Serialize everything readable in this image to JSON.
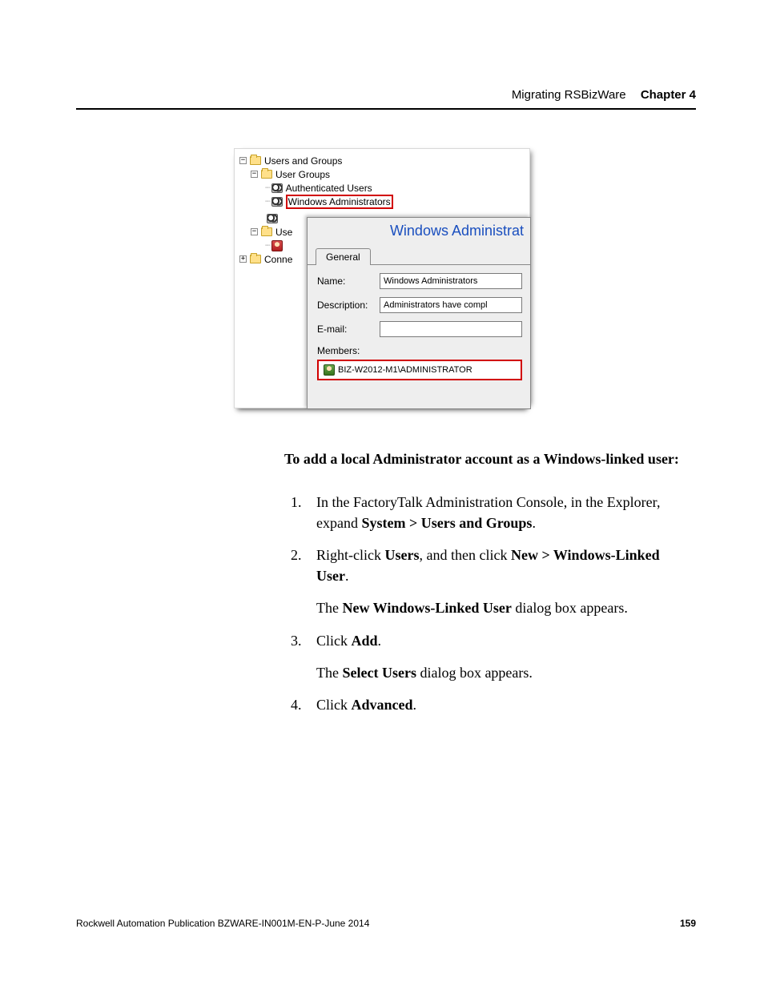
{
  "header": {
    "title": "Migrating RSBizWare",
    "chapter": "Chapter 4"
  },
  "figure": {
    "tree": {
      "root": "Users and Groups",
      "user_groups": "User Groups",
      "auth_users": "Authenticated Users",
      "win_admins": "Windows Administrators",
      "users_trunc": "Use",
      "conn_trunc": "Conne"
    },
    "panel": {
      "title": "Windows Administrat",
      "tab": "General",
      "name_label": "Name:",
      "name_value": "Windows Administrators",
      "desc_label": "Description:",
      "desc_value": "Administrators have compl",
      "email_label": "E-mail:",
      "email_value": "",
      "members_label": "Members:",
      "member_value": "BIZ-W2012-M1\\ADMINISTRATOR"
    }
  },
  "body": {
    "heading": "To add a local Administrator account as a Windows-linked user:",
    "steps": {
      "s1a": "In the FactoryTalk Administration Console, in the Explorer, expand ",
      "s1b": "System > Users and Groups",
      "s1c": ".",
      "s2a": "Right-click ",
      "s2b": "Users",
      "s2c": ", and then click ",
      "s2d": "New > Windows-Linked User",
      "s2e": ".",
      "s2f": "The ",
      "s2g": "New Windows-Linked User",
      "s2h": " dialog box appears.",
      "s3a": "Click ",
      "s3b": "Add",
      "s3c": ".",
      "s3d": "The ",
      "s3e": "Select Users",
      "s3f": " dialog box appears.",
      "s4a": "Click ",
      "s4b": "Advanced",
      "s4c": "."
    }
  },
  "footer": {
    "pub": "Rockwell Automation Publication BZWARE-IN001M-EN-P-June 2014",
    "page": "159"
  }
}
